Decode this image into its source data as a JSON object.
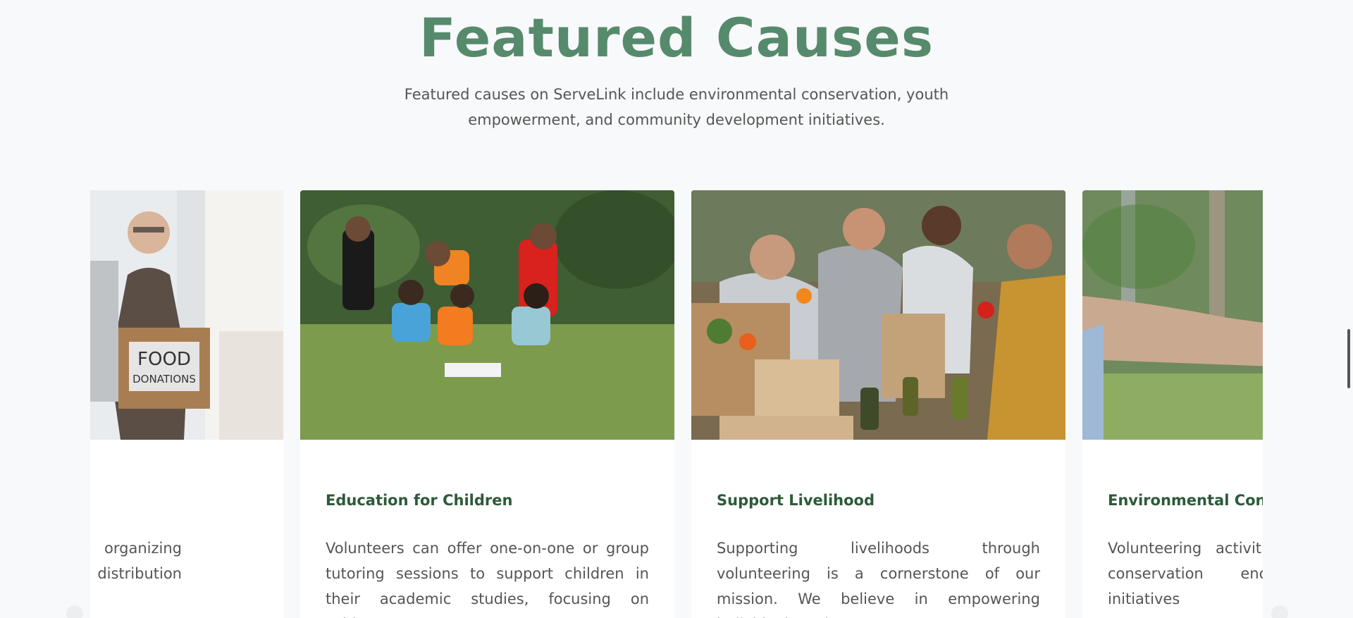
{
  "section": {
    "title": "Featured Causes",
    "subtitle": "Featured causes on ServeLink include environmental conservation, youth empowerment, and community development initiatives."
  },
  "cards": [
    {
      "title": "",
      "text": "\"Food for Community\" involves organizing food collection drives and meal distribution events. Volunteers can",
      "image_alt": "Volunteer holding a food donations box",
      "box_label_1": "FOOD",
      "box_label_2": "DONATIONS"
    },
    {
      "title": "Education for Children",
      "text": "Volunteers can offer one-on-one or group tutoring sessions to support children in their academic studies, focusing on subjects",
      "image_alt": "Children reading together on grass"
    },
    {
      "title": "Support Livelihood",
      "text": "Supporting livelihoods through volunteering is a cornerstone of our mission. We believe in empowering individuals and",
      "image_alt": "Volunteers sorting food and produce"
    },
    {
      "title": "Environmental Conservation",
      "text": "Volunteering activities in environmental conservation encompass impactful initiatives",
      "image_alt": "Hands holding a seedling"
    }
  ],
  "colors": {
    "title_green": "#568a6c",
    "card_title_green": "#2c5a3a",
    "background": "#f8f9fa"
  }
}
